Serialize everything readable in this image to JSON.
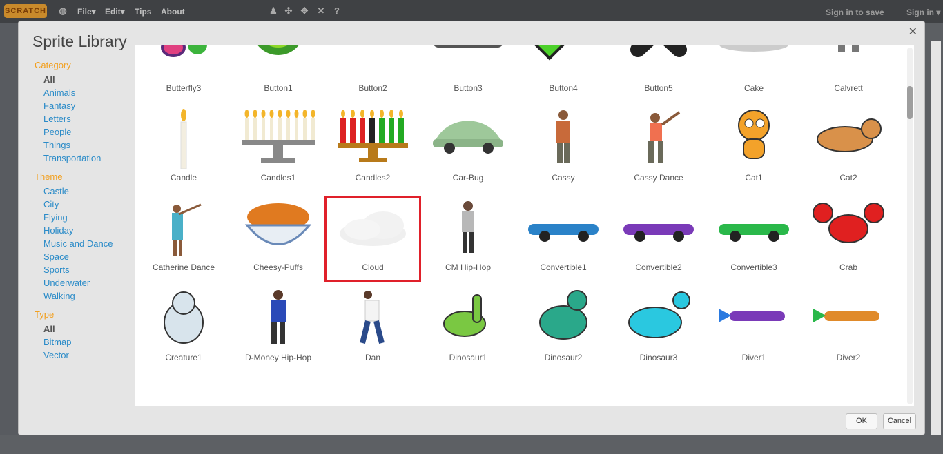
{
  "topbar": {
    "logo": "SCRATCH",
    "menus": [
      "File▾",
      "Edit▾",
      "Tips",
      "About"
    ],
    "sign_in_to_save": "Sign in to save",
    "sign_in": "Sign in ▾"
  },
  "dialog": {
    "title": "Sprite Library",
    "close": "✕",
    "ok": "OK",
    "cancel": "Cancel"
  },
  "sidebar": {
    "category": {
      "heading": "Category",
      "items": [
        "All",
        "Animals",
        "Fantasy",
        "Letters",
        "People",
        "Things",
        "Transportation"
      ],
      "selected": "All"
    },
    "theme": {
      "heading": "Theme",
      "items": [
        "Castle",
        "City",
        "Flying",
        "Holiday",
        "Music and Dance",
        "Space",
        "Sports",
        "Underwater",
        "Walking"
      ]
    },
    "type": {
      "heading": "Type",
      "items": [
        "All",
        "Bitmap",
        "Vector"
      ],
      "selected": "All"
    }
  },
  "sprites": [
    {
      "name": "Butterfly3",
      "icon": "butterfly"
    },
    {
      "name": "Button1",
      "icon": "button-round-green"
    },
    {
      "name": "Button2",
      "icon": "button-blue"
    },
    {
      "name": "Button3",
      "icon": "button-gray"
    },
    {
      "name": "Button4",
      "icon": "check"
    },
    {
      "name": "Button5",
      "icon": "x-mark"
    },
    {
      "name": "Cake",
      "icon": "cake"
    },
    {
      "name": "Calvrett",
      "icon": "dancer"
    },
    {
      "name": "Candle",
      "icon": "candle"
    },
    {
      "name": "Candles1",
      "icon": "menorah"
    },
    {
      "name": "Candles2",
      "icon": "kinara"
    },
    {
      "name": "Car-Bug",
      "icon": "car-bug"
    },
    {
      "name": "Cassy",
      "icon": "person"
    },
    {
      "name": "Cassy Dance",
      "icon": "person-dance"
    },
    {
      "name": "Cat1",
      "icon": "cat-scratch"
    },
    {
      "name": "Cat2",
      "icon": "cat-crawl"
    },
    {
      "name": "Catherine Dance",
      "icon": "person-dance2"
    },
    {
      "name": "Cheesy-Puffs",
      "icon": "bowl-snacks"
    },
    {
      "name": "Cloud",
      "icon": "cloud"
    },
    {
      "name": "CM Hip-Hop",
      "icon": "person-hiphop"
    },
    {
      "name": "Convertible1",
      "icon": "convertible-blue"
    },
    {
      "name": "Convertible2",
      "icon": "convertible-purple"
    },
    {
      "name": "Convertible3",
      "icon": "convertible-green"
    },
    {
      "name": "Crab",
      "icon": "crab"
    },
    {
      "name": "Creature1",
      "icon": "yeti"
    },
    {
      "name": "D-Money Hip-Hop",
      "icon": "person-hiphop2"
    },
    {
      "name": "Dan",
      "icon": "person-breakdance"
    },
    {
      "name": "Dinosaur1",
      "icon": "dino-green"
    },
    {
      "name": "Dinosaur2",
      "icon": "dino-teal"
    },
    {
      "name": "Dinosaur3",
      "icon": "dino-cyan"
    },
    {
      "name": "Diver1",
      "icon": "diver-purple"
    },
    {
      "name": "Diver2",
      "icon": "diver-green"
    },
    {
      "name": "",
      "icon": "partial-1"
    },
    {
      "name": "",
      "icon": "partial-dog"
    },
    {
      "name": "",
      "icon": "partial-dog2"
    },
    {
      "name": "",
      "icon": "partial-donut"
    },
    {
      "name": "",
      "icon": "partial-dove"
    },
    {
      "name": "",
      "icon": "partial-fish"
    },
    {
      "name": "",
      "icon": "partial-dragon"
    },
    {
      "name": "",
      "icon": "partial-drum"
    }
  ],
  "selected_sprite": "Cloud",
  "colors": {
    "accent_heading": "#f2a020",
    "link": "#2a8bc8",
    "selection": "#e0202a"
  }
}
